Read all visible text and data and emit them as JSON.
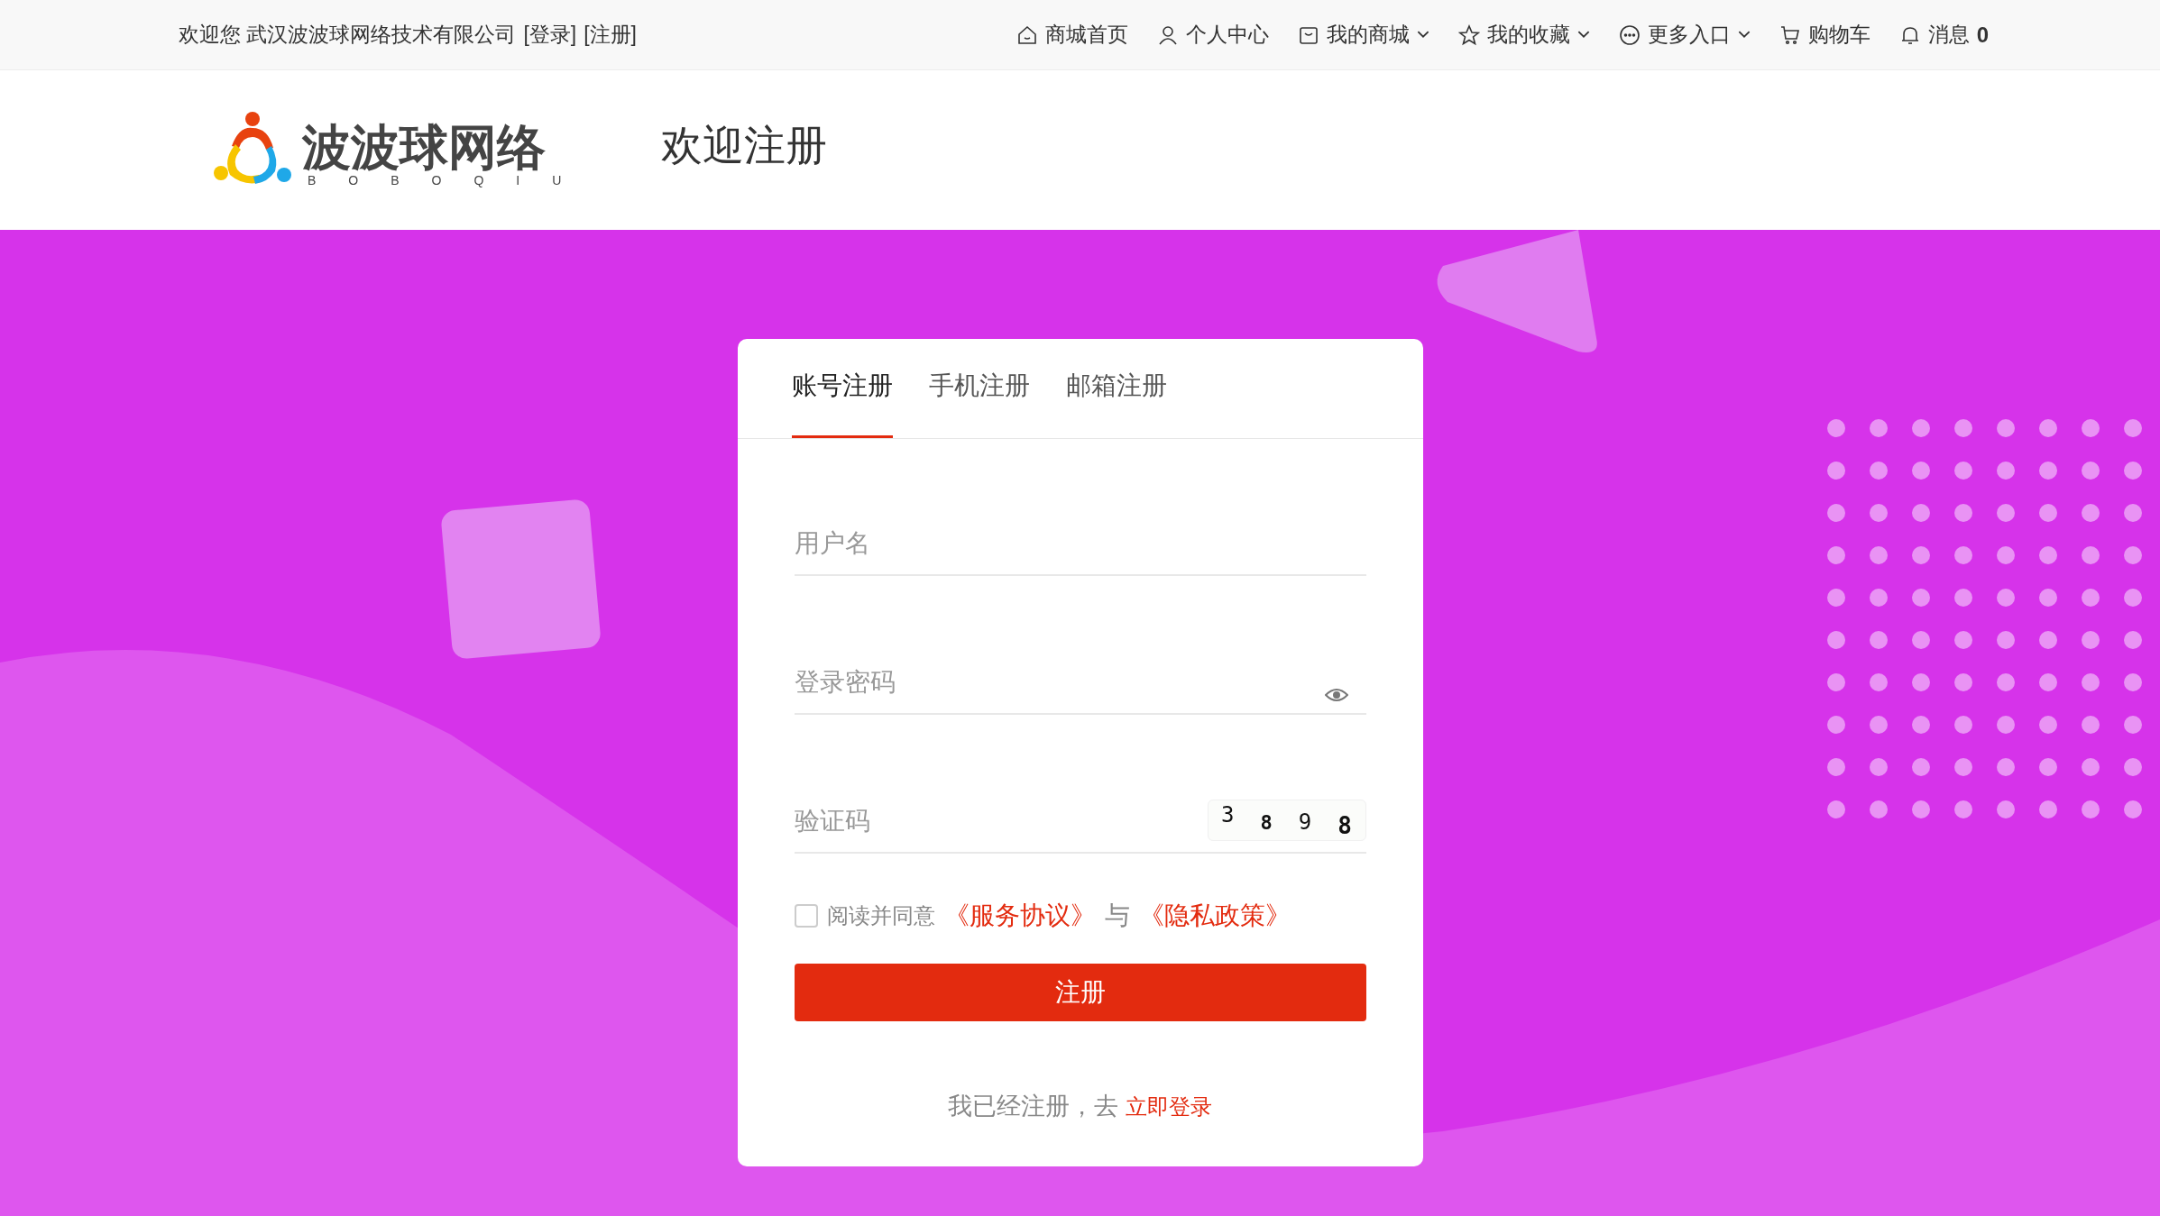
{
  "top_bar": {
    "welcome": "欢迎您 武汉波波球网络技术有限公司",
    "links": [
      "[登录]",
      "[注册]"
    ],
    "nav": [
      {
        "kind": "home",
        "label": "商城首页",
        "dropdown": false
      },
      {
        "kind": "user",
        "label": "个人中心",
        "dropdown": false
      },
      {
        "kind": "shop",
        "label": "我的商城",
        "dropdown": true
      },
      {
        "kind": "star",
        "label": "我的收藏",
        "dropdown": true
      },
      {
        "kind": "more",
        "label": "更多入口",
        "dropdown": true
      },
      {
        "kind": "cart",
        "label": "购物车",
        "dropdown": false
      },
      {
        "kind": "bell",
        "label": "消息",
        "dropdown": false,
        "count": "0"
      }
    ]
  },
  "header": {
    "logo": {
      "name": "波波球网络",
      "sub": "BOBOQIU"
    },
    "title": "欢迎注册"
  },
  "tabs": [
    {
      "label": "账号注册",
      "selected": true
    },
    {
      "label": "手机注册",
      "selected": false
    },
    {
      "label": "邮箱注册",
      "selected": false
    }
  ],
  "fields": [
    {
      "kind": "text",
      "placeholder": "用户名"
    },
    {
      "kind": "password",
      "placeholder": "登录密码"
    },
    {
      "kind": "captcha",
      "placeholder": "验证码",
      "captcha": [
        "3",
        "8",
        "9",
        "8"
      ]
    }
  ],
  "agreement": {
    "checked": false,
    "text": "阅读并同意",
    "links": [
      "《服务协议》",
      "《隐私政策》"
    ],
    "joiner": "与"
  },
  "submit": "注册",
  "footer": {
    "text": "我已经注册，去",
    "link": "立即登录"
  }
}
